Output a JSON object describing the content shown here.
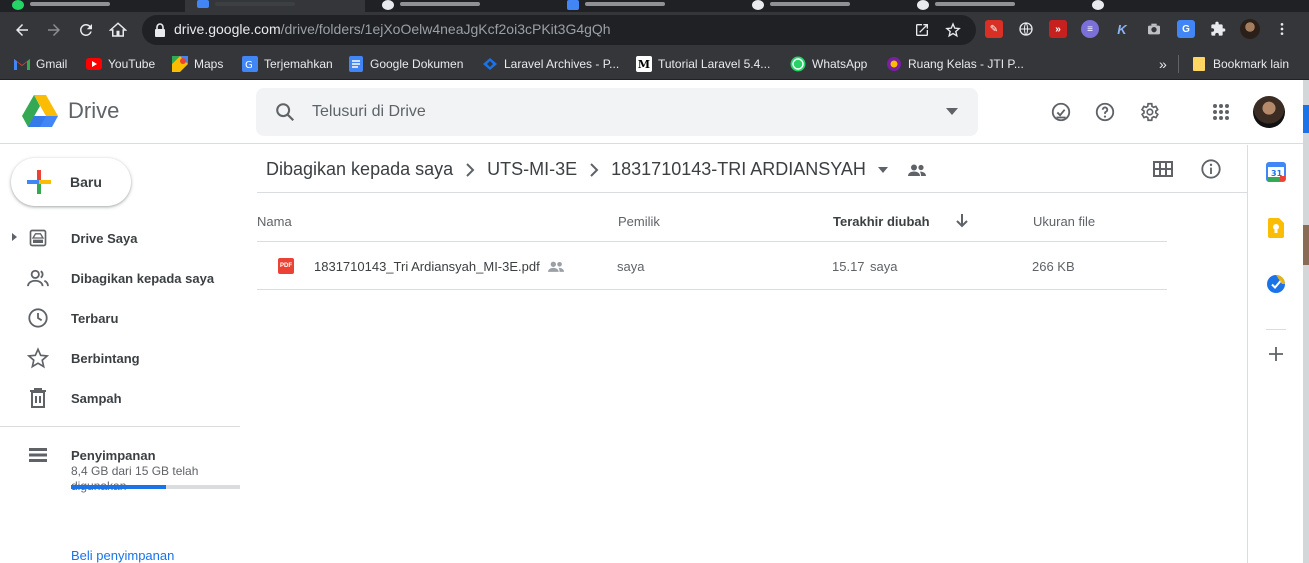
{
  "browser": {
    "url_host": "drive.google.com",
    "url_path": "/drive/folders/1ejXoOelw4neaJgKcf2oi3cPKit3G4gQh",
    "bookmarks": [
      {
        "label": "Gmail",
        "icon": "gmail-icon"
      },
      {
        "label": "YouTube",
        "icon": "youtube-icon"
      },
      {
        "label": "Maps",
        "icon": "maps-icon"
      },
      {
        "label": "Terjemahkan",
        "icon": "translate-icon"
      },
      {
        "label": "Google Dokumen",
        "icon": "docs-icon"
      },
      {
        "label": "Laravel Archives - P...",
        "icon": "laravel-icon"
      },
      {
        "label": "Tutorial Laravel 5.4...",
        "icon": "medium-icon"
      },
      {
        "label": "WhatsApp",
        "icon": "whatsapp-icon"
      },
      {
        "label": "Ruang Kelas - JTI P...",
        "icon": "campus-icon"
      }
    ],
    "more_bookmarks": "»",
    "other_bookmarks": "Bookmark lain"
  },
  "drive": {
    "product_name": "Drive",
    "search_placeholder": "Telusuri di Drive",
    "new_button": "Baru",
    "nav": [
      {
        "label": "Drive Saya",
        "icon": "my-drive-icon"
      },
      {
        "label": "Dibagikan kepada saya",
        "icon": "shared-icon"
      },
      {
        "label": "Terbaru",
        "icon": "clock-icon"
      },
      {
        "label": "Berbintang",
        "icon": "star-icon"
      },
      {
        "label": "Sampah",
        "icon": "trash-icon"
      }
    ],
    "storage": {
      "label": "Penyimpanan",
      "usage_text": "8,4 GB dari 15 GB telah digunakan",
      "used_fraction": 0.56,
      "buy_link": "Beli penyimpanan"
    },
    "breadcrumb": [
      "Dibagikan kepada saya",
      "UTS-MI-3E",
      "1831710143-TRI ARDIANSYAH"
    ],
    "columns": {
      "name": "Nama",
      "owner": "Pemilik",
      "modified": "Terakhir diubah",
      "size": "Ukuran file"
    },
    "files": [
      {
        "name": "1831710143_Tri Ardiansyah_MI-3E.pdf",
        "type_badge": "PDF",
        "owner": "saya",
        "modified_time": "15.17",
        "modified_by": "saya",
        "size": "266 KB"
      }
    ],
    "side_panel": {
      "calendar_day": "31"
    },
    "colors": {
      "accent_blue": "#1a73e8",
      "pdf_red": "#ea4335",
      "keep_yellow": "#fbbc04",
      "chrome_dark": "#35363a"
    }
  }
}
